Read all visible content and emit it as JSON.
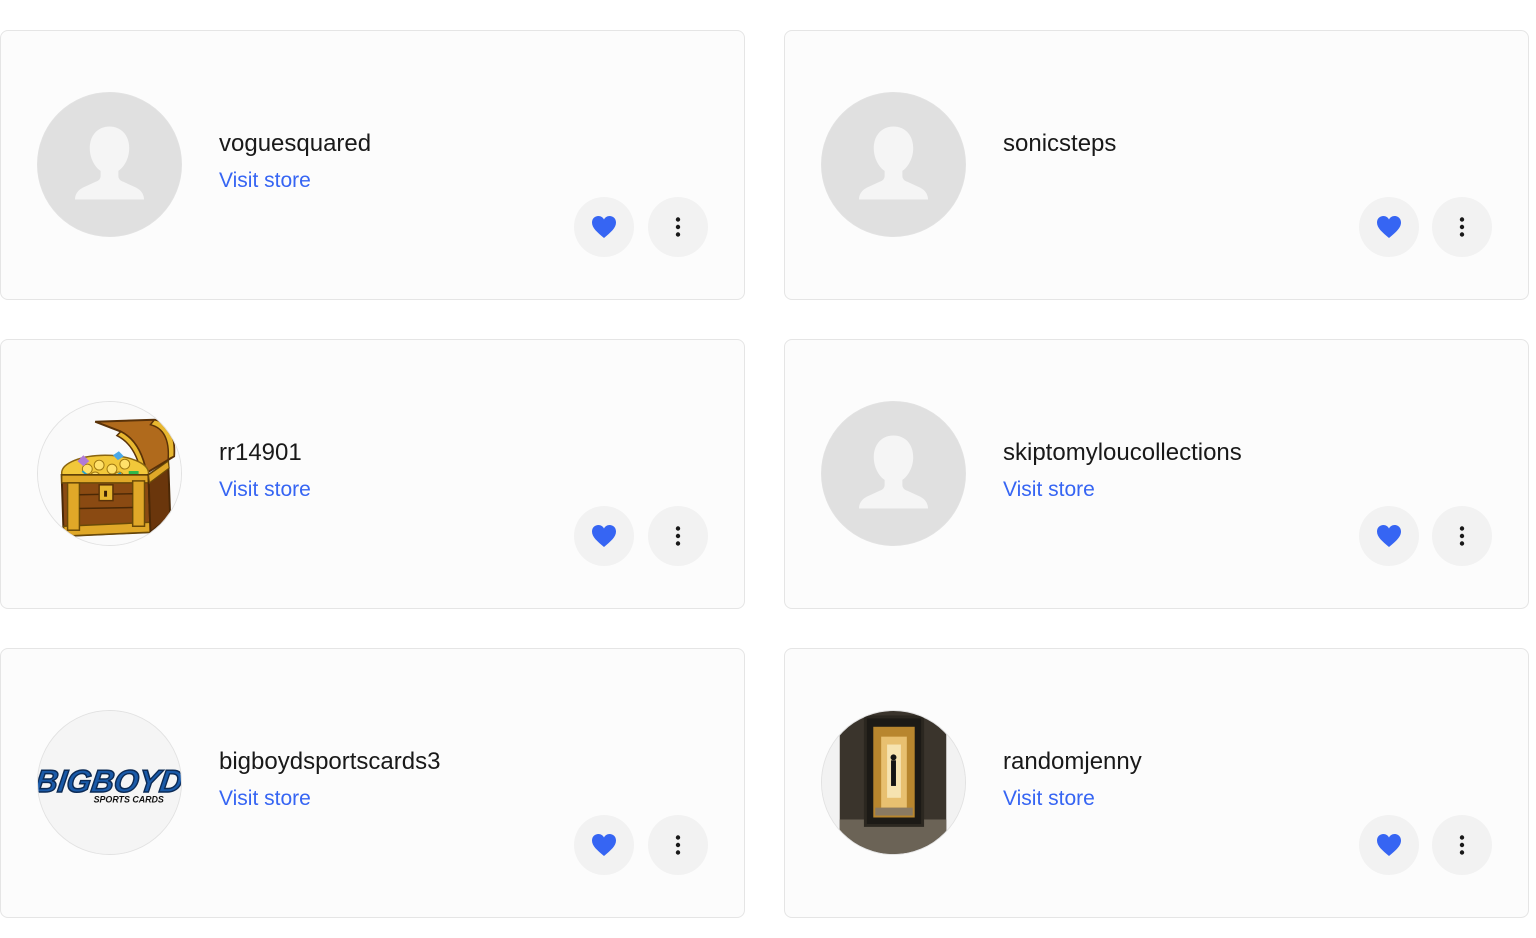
{
  "colors": {
    "link": "#3665f3",
    "heart": "#3665f3",
    "button_bg": "#f2f2f2",
    "card_border": "#e5e5e5"
  },
  "stores": [
    {
      "name": "voguesquared",
      "visit_label": "Visit store",
      "avatar": "default-avatar"
    },
    {
      "name": "sonicsteps",
      "visit_label": "",
      "avatar": "default-avatar"
    },
    {
      "name": "rr14901",
      "visit_label": "Visit store",
      "avatar": "treasure-chest-image"
    },
    {
      "name": "skiptomyloucollections",
      "visit_label": "Visit store",
      "avatar": "default-avatar"
    },
    {
      "name": "bigboydsportscards3",
      "visit_label": "Visit store",
      "avatar": "bigboyd-logo",
      "logo_text": "BIGBOYD",
      "logo_subtext": "SPORTS CARDS"
    },
    {
      "name": "randomjenny",
      "visit_label": "Visit store",
      "avatar": "mirror-photo"
    }
  ],
  "icons": {
    "favorite": "heart-filled-icon",
    "more": "vertical-dots-icon",
    "placeholder": "person-silhouette-icon"
  }
}
